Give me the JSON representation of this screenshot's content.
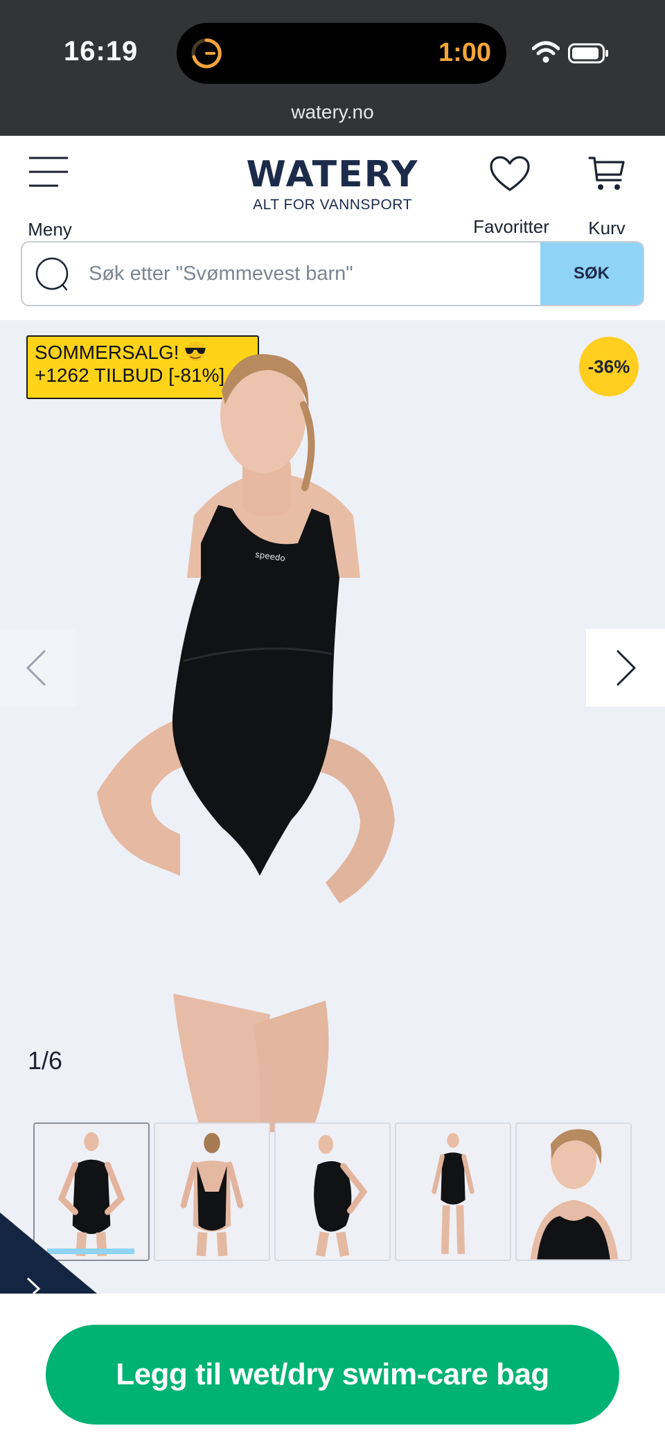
{
  "status_bar": {
    "time": "16:19",
    "timer": "1:00",
    "url": "watery.no"
  },
  "header": {
    "menu_label": "Meny",
    "logo_title": "WATERY",
    "logo_subtitle": "ALT FOR VANNSPORT",
    "favorites_label": "Favoritter",
    "cart_label": "Kurv"
  },
  "search": {
    "placeholder": "Søk etter \"Svømmevest barn\"",
    "button_label": "SØK"
  },
  "gallery": {
    "promo_line1": "SOMMERSALG!",
    "promo_line2": "+1262 TILBUD [-81%]",
    "discount_badge": "-36%",
    "counter": "1/6",
    "thumbnail_count": 5,
    "active_thumbnail": 1
  },
  "cta": {
    "label": "Legg til wet/dry swim-care bag"
  },
  "colors": {
    "brand_navy": "#1c2b4a",
    "search_button": "#8fd3f7",
    "promo_yellow": "#ffd31a",
    "cta_green": "#00b274",
    "gallery_bg": "#eef0f7"
  }
}
